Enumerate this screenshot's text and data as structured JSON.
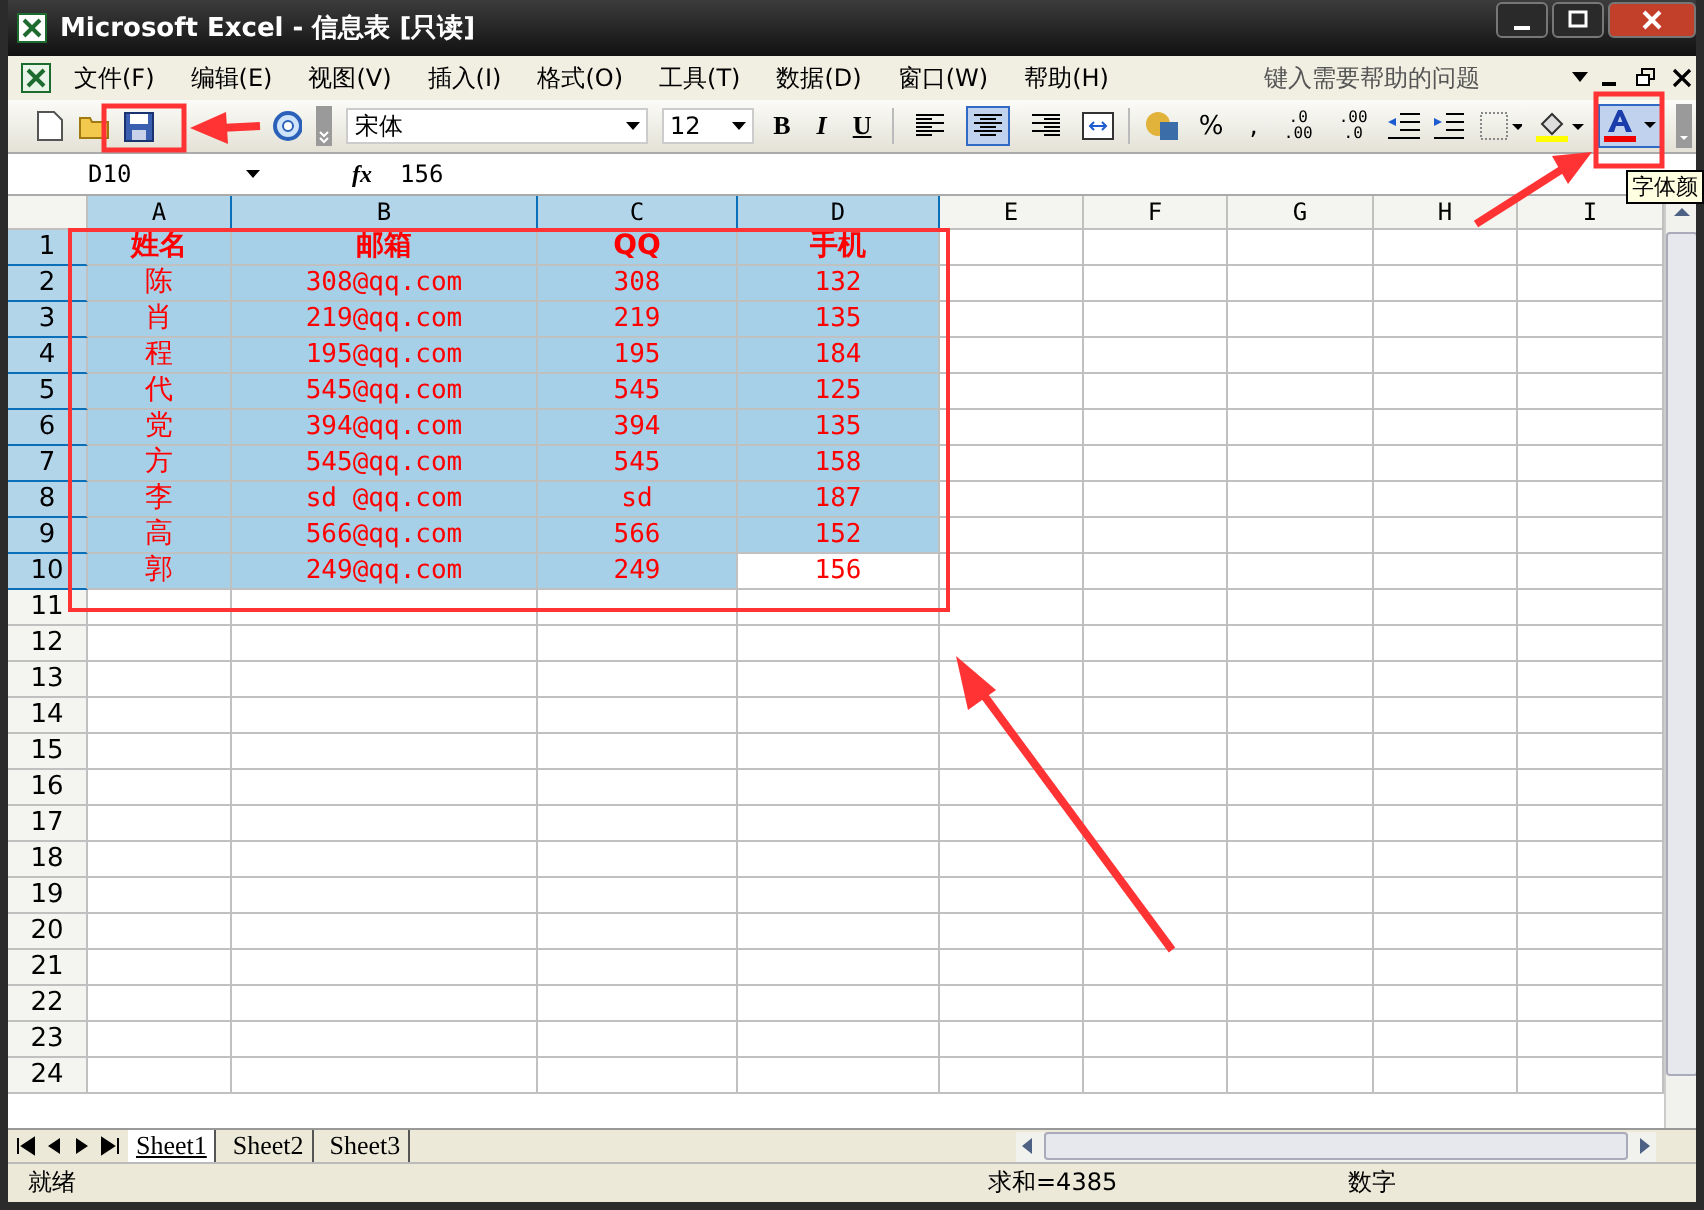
{
  "window": {
    "title": "Microsoft Excel - 信息表  [只读]"
  },
  "menu": {
    "items": [
      "文件(F)",
      "编辑(E)",
      "视图(V)",
      "插入(I)",
      "格式(O)",
      "工具(T)",
      "数据(D)",
      "窗口(W)",
      "帮助(H)"
    ],
    "help_placeholder": "键入需要帮助的问题"
  },
  "toolbar": {
    "font": "宋体",
    "size": "12",
    "format_buttons": [
      "B",
      "I",
      "U"
    ],
    "alignment_buttons": [
      {
        "selected": false
      },
      {
        "selected": true
      },
      {
        "selected": false
      }
    ],
    "number_buttons": [
      "%",
      ","
    ],
    "decimal_buttons": [
      {
        "top": ".0",
        "bottom": ".00"
      },
      {
        "top": ".00",
        "bottom": ".0"
      }
    ],
    "tooltip": "字体颜"
  },
  "formula_bar": {
    "name_box": "D10",
    "fx": "fx",
    "value": "156"
  },
  "columns": [
    {
      "label": "A",
      "selected": true
    },
    {
      "label": "B",
      "selected": true
    },
    {
      "label": "C",
      "selected": true
    },
    {
      "label": "D",
      "selected": true
    },
    {
      "label": "E",
      "selected": false
    },
    {
      "label": "F",
      "selected": false
    },
    {
      "label": "G",
      "selected": false
    },
    {
      "label": "H",
      "selected": false
    },
    {
      "label": "I",
      "selected": false
    }
  ],
  "rows": [
    {
      "header": "1",
      "selected": true,
      "kind": "header",
      "cells": [
        {
          "text": "姓名",
          "active": false
        },
        {
          "text": "邮箱",
          "active": false
        },
        {
          "text": "QQ",
          "active": false
        },
        {
          "text": "手机",
          "active": false
        }
      ]
    },
    {
      "header": "2",
      "selected": true,
      "kind": "data",
      "cells": [
        {
          "text": "陈",
          "active": false
        },
        {
          "text": "308@qq.com",
          "active": false
        },
        {
          "text": "308",
          "active": false
        },
        {
          "text": "132",
          "active": false
        }
      ]
    },
    {
      "header": "3",
      "selected": true,
      "kind": "data",
      "cells": [
        {
          "text": "肖",
          "active": false
        },
        {
          "text": "219@qq.com",
          "active": false
        },
        {
          "text": "219",
          "active": false
        },
        {
          "text": "135",
          "active": false
        }
      ]
    },
    {
      "header": "4",
      "selected": true,
      "kind": "data",
      "cells": [
        {
          "text": "程",
          "active": false
        },
        {
          "text": "195@qq.com",
          "active": false
        },
        {
          "text": "195",
          "active": false
        },
        {
          "text": "184",
          "active": false
        }
      ]
    },
    {
      "header": "5",
      "selected": true,
      "kind": "data",
      "cells": [
        {
          "text": "代",
          "active": false
        },
        {
          "text": "545@qq.com",
          "active": false
        },
        {
          "text": "545",
          "active": false
        },
        {
          "text": "125",
          "active": false
        }
      ]
    },
    {
      "header": "6",
      "selected": true,
      "kind": "data",
      "cells": [
        {
          "text": "党",
          "active": false
        },
        {
          "text": "394@qq.com",
          "active": false
        },
        {
          "text": "394",
          "active": false
        },
        {
          "text": "135",
          "active": false
        }
      ]
    },
    {
      "header": "7",
      "selected": true,
      "kind": "data",
      "cells": [
        {
          "text": "方",
          "active": false
        },
        {
          "text": "545@qq.com",
          "active": false
        },
        {
          "text": "545",
          "active": false
        },
        {
          "text": "158",
          "active": false
        }
      ]
    },
    {
      "header": "8",
      "selected": true,
      "kind": "data",
      "cells": [
        {
          "text": "李",
          "active": false
        },
        {
          "text": "sd @qq.com",
          "active": false
        },
        {
          "text": "sd",
          "active": false
        },
        {
          "text": "187",
          "active": false
        }
      ]
    },
    {
      "header": "9",
      "selected": true,
      "kind": "data",
      "cells": [
        {
          "text": "高",
          "active": false
        },
        {
          "text": "566@qq.com",
          "active": false
        },
        {
          "text": "566",
          "active": false
        },
        {
          "text": "152",
          "active": false
        }
      ]
    },
    {
      "header": "10",
      "selected": true,
      "kind": "data",
      "cells": [
        {
          "text": "郭",
          "active": false
        },
        {
          "text": "249@qq.com",
          "active": false
        },
        {
          "text": "249",
          "active": false
        },
        {
          "text": "156",
          "active": true
        }
      ]
    },
    {
      "header": "11",
      "selected": false,
      "cells": []
    },
    {
      "header": "12",
      "selected": false,
      "cells": []
    },
    {
      "header": "13",
      "selected": false,
      "cells": []
    },
    {
      "header": "14",
      "selected": false,
      "cells": []
    },
    {
      "header": "15",
      "selected": false,
      "cells": []
    },
    {
      "header": "16",
      "selected": false,
      "cells": []
    },
    {
      "header": "17",
      "selected": false,
      "cells": []
    },
    {
      "header": "18",
      "selected": false,
      "cells": []
    },
    {
      "header": "19",
      "selected": false,
      "cells": []
    },
    {
      "header": "20",
      "selected": false,
      "cells": []
    },
    {
      "header": "21",
      "selected": false,
      "cells": []
    },
    {
      "header": "22",
      "selected": false,
      "cells": []
    },
    {
      "header": "23",
      "selected": false,
      "cells": []
    },
    {
      "header": "24",
      "selected": false,
      "cells": []
    }
  ],
  "sheets": [
    {
      "label": "Sheet1",
      "selected": true
    },
    {
      "label": "Sheet2",
      "selected": false
    },
    {
      "label": "Sheet3",
      "selected": false
    }
  ],
  "status_bar": {
    "state": "就绪",
    "sum": "求和=4385",
    "mode": "数字"
  }
}
